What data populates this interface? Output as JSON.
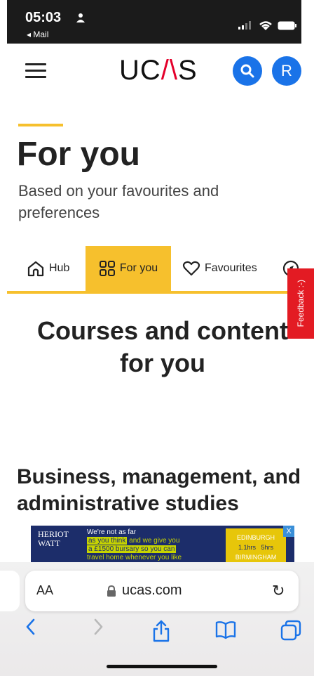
{
  "status_bar": {
    "time": "05:03",
    "back_app": "◂ Mail"
  },
  "header": {
    "logo_left": "UC",
    "logo_wedge": "/\\",
    "logo_right": "S",
    "profile_initial": "R",
    "accent_color": "#1a73e8"
  },
  "page": {
    "title": "For you",
    "subtitle": "Based on your favourites and preferences"
  },
  "tabs": [
    {
      "label": "Hub",
      "icon": "home-icon"
    },
    {
      "label": "For you",
      "icon": "grid-icon",
      "active": true
    },
    {
      "label": "Favourites",
      "icon": "heart-icon"
    }
  ],
  "feedback": {
    "label": "Feedback :-)"
  },
  "section": {
    "heading": "Courses and content for you"
  },
  "subject": {
    "heading": "Business, management, and administrative studies"
  },
  "ad": {
    "logo_line1": "HERIOT",
    "logo_line2": "WATT",
    "copy_1": "We're not as far",
    "copy_2": "as you think",
    "copy_3": "and we give you",
    "copy_4": "a £1500 bursary so you can",
    "copy_5": "travel home whenever you like",
    "city_1": "EDINBURGH",
    "time_1": "1.1hrs",
    "time_2": "5hrs",
    "city_2": "BIRMINGHAM",
    "close": "X"
  },
  "browser": {
    "aa_label": "AA",
    "url": "ucas.com",
    "reload": "↻"
  },
  "colors": {
    "yellow": "#f6c02d",
    "blue": "#1a73e8",
    "feedback_red": "#e31b23"
  }
}
